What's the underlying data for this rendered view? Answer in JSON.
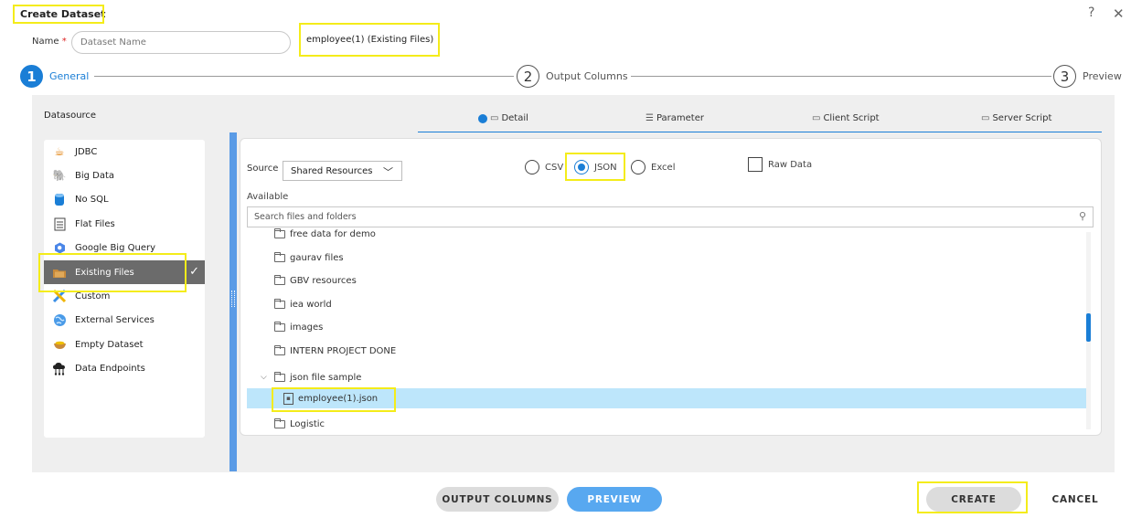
{
  "dialog": {
    "title": "Create Dataset",
    "help_glyph": "?",
    "close_glyph": "✕",
    "name_label": "Name",
    "name_required_mark": "*",
    "name_placeholder": "Dataset Name",
    "selected_file_caption": "employee(1) (Existing Files)"
  },
  "steps": [
    {
      "number": "1",
      "label": "General",
      "active": true
    },
    {
      "number": "2",
      "label": "Output Columns",
      "active": false
    },
    {
      "number": "3",
      "label": "Preview",
      "active": false
    }
  ],
  "datasource": {
    "title": "Datasource",
    "items": [
      {
        "label": "JDBC",
        "icon": "java-icon"
      },
      {
        "label": "Big Data",
        "icon": "elephant-icon"
      },
      {
        "label": "No SQL",
        "icon": "database-icon"
      },
      {
        "label": "Flat Files",
        "icon": "spreadsheet-icon"
      },
      {
        "label": "Google Big Query",
        "icon": "bigquery-icon"
      },
      {
        "label": "Existing Files",
        "icon": "folder-files-icon",
        "selected": true
      },
      {
        "label": "Custom",
        "icon": "tools-icon"
      },
      {
        "label": "External Services",
        "icon": "globe-icon"
      },
      {
        "label": "Empty Dataset",
        "icon": "empty-bowl-icon"
      },
      {
        "label": "Data Endpoints",
        "icon": "cloud-network-icon"
      }
    ]
  },
  "tabs": [
    {
      "label": "Detail",
      "icon": "detail-icon",
      "active": true
    },
    {
      "label": "Parameter",
      "icon": "sliders-icon"
    },
    {
      "label": "Client Script",
      "icon": "client-script-icon"
    },
    {
      "label": "Server Script",
      "icon": "server-script-icon"
    }
  ],
  "detail": {
    "source_label": "Source",
    "source_value": "Shared Resources",
    "formats": [
      {
        "label": "CSV",
        "checked": false
      },
      {
        "label": "JSON",
        "checked": true
      },
      {
        "label": "Excel",
        "checked": false
      }
    ],
    "raw_data_label": "Raw Data",
    "raw_data_checked": false,
    "available_label": "Available",
    "search_placeholder": "Search files and folders",
    "tree": [
      {
        "label": "free data for demo",
        "kind": "folder",
        "indent": 1
      },
      {
        "label": "gaurav files",
        "kind": "folder",
        "indent": 1
      },
      {
        "label": "GBV resources",
        "kind": "folder",
        "indent": 1
      },
      {
        "label": "iea world",
        "kind": "folder",
        "indent": 1
      },
      {
        "label": "images",
        "kind": "folder",
        "indent": 1
      },
      {
        "label": "INTERN PROJECT DONE",
        "kind": "folder",
        "indent": 1
      },
      {
        "label": "json file sample",
        "kind": "folder-open",
        "indent": 0
      },
      {
        "label": "employee(1).json",
        "kind": "file",
        "indent": 2,
        "selected": true
      },
      {
        "label": "Logistic",
        "kind": "folder",
        "indent": 1
      }
    ]
  },
  "buttons": {
    "output_columns": "OUTPUT COLUMNS",
    "preview": "PREVIEW",
    "create": "CREATE",
    "cancel": "CANCEL"
  },
  "colors": {
    "accent": "#1a7ed6",
    "highlight": "#f4ec1a",
    "selected_row": "#bde6fb",
    "selected_datasource": "#6b6b6b"
  }
}
